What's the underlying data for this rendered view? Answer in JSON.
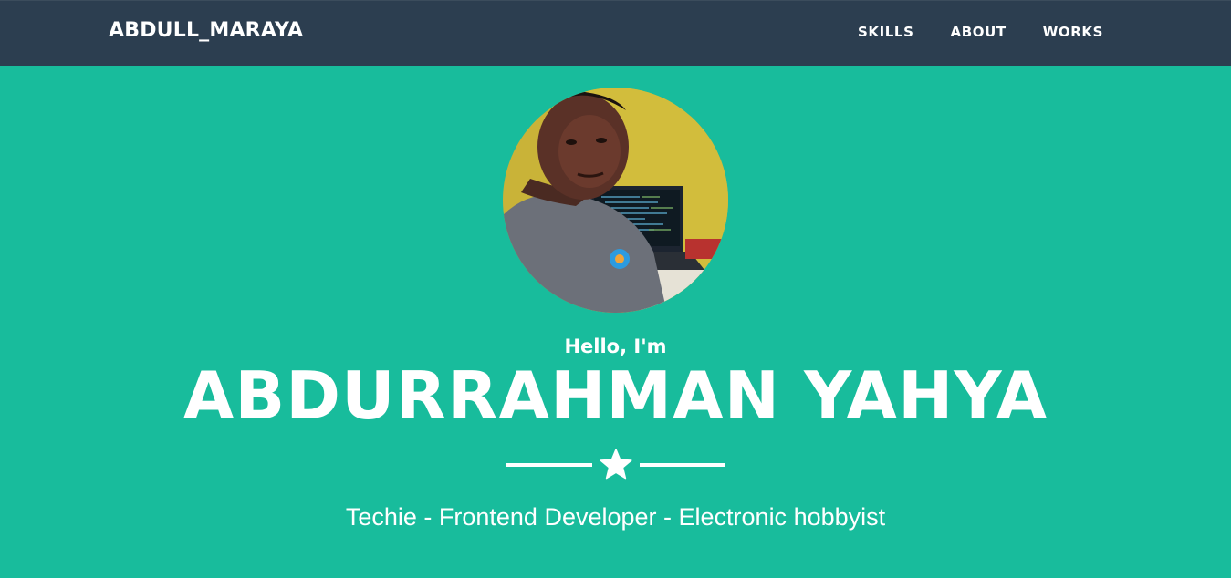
{
  "navbar": {
    "brand": "ABDULL_MARAYA",
    "links": [
      {
        "label": "SKILLS"
      },
      {
        "label": "ABOUT"
      },
      {
        "label": "WORKS"
      }
    ]
  },
  "hero": {
    "avatar_icon": "profile-photo",
    "greeting": "Hello, I'm",
    "name": "ABDURRAHMAN YAHYA",
    "divider_icon": "star-icon",
    "tagline": "Techie - Frontend Developer - Electronic hobbyist"
  },
  "colors": {
    "navbar_bg": "#2c3e50",
    "hero_bg": "#18bc9c",
    "text": "#ffffff"
  }
}
